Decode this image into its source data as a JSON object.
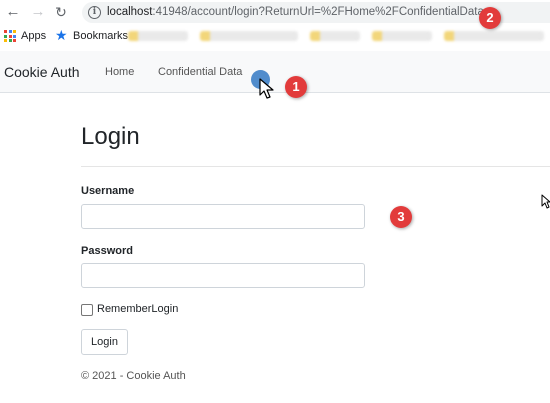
{
  "browser": {
    "url_host": "localhost",
    "url_rest": ":41948/account/login?ReturnUrl=%2FHome%2FConfidentialData",
    "bookmarks": {
      "apps_label": "Apps",
      "bookmarks_label": "Bookmarks"
    },
    "icons": {
      "back": "arrow-left-icon",
      "forward": "arrow-right-icon",
      "reload": "reload-icon",
      "info": "info-icon",
      "apps": "apps-grid-icon",
      "bookmarks": "star-icon"
    }
  },
  "navbar": {
    "brand": "Cookie Auth",
    "links": [
      {
        "label": "Home"
      },
      {
        "label": "Confidential Data"
      }
    ],
    "background": "#f8f9fa"
  },
  "login": {
    "title": "Login",
    "username_label": "Username",
    "username_value": "",
    "password_label": "Password",
    "password_value": "",
    "remember_label": "RememberLogin",
    "remember_checked": false,
    "submit_label": "Login"
  },
  "footer": {
    "text": "© 2021 - Cookie Auth"
  },
  "annotations": {
    "color": "#e23b3b",
    "badges": [
      "1",
      "2",
      "3"
    ]
  }
}
